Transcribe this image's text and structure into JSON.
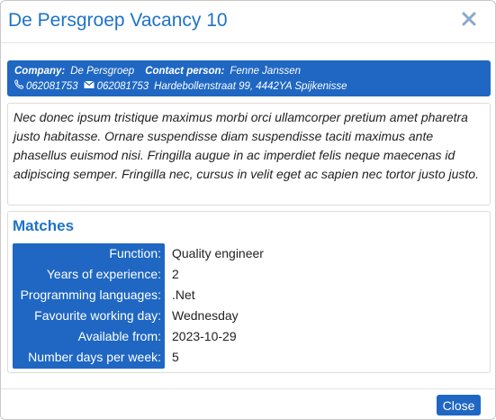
{
  "modal": {
    "title": "De Persgroep Vacancy 10",
    "close_icon": "close-x-icon"
  },
  "info": {
    "company_label": "Company:",
    "company": "De Persgroep",
    "contact_label": "Contact person:",
    "contact": "Fenne Janssen",
    "phone_icon": "phone-icon",
    "phone": "062081753",
    "fax_icon": "envelope-icon",
    "fax": "062081753",
    "address": "Hardebollenstraat 99, 4442YA Spijkenisse"
  },
  "description": "Nec donec ipsum tristique maximus morbi orci ullamcorper pretium amet pharetra justo habitasse. Ornare suspendisse diam suspendisse taciti maximus ante phasellus euismod nisi. Fringilla augue in ac imperdiet felis neque maecenas id adipiscing semper. Fringilla nec, cursus in velit eget ac sapien nec tortor justo justo.",
  "matches": {
    "title": "Matches",
    "rows": [
      {
        "label": "Function:",
        "value": "Quality engineer"
      },
      {
        "label": "Years of experience:",
        "value": "2"
      },
      {
        "label": "Programming languages:",
        "value": ".Net"
      },
      {
        "label": "Favourite working day:",
        "value": "Wednesday"
      },
      {
        "label": "Available from:",
        "value": "2023-10-29"
      },
      {
        "label": "Number days per week:",
        "value": "5"
      }
    ]
  },
  "footer": {
    "close_label": "Close"
  },
  "colors": {
    "accent": "#1f67c2",
    "title": "#1e73c7"
  }
}
